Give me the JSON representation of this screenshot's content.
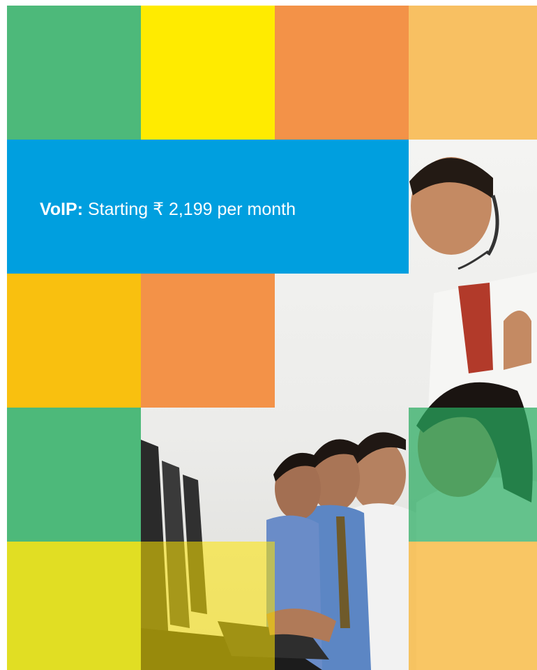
{
  "banner": {
    "label": "VoIP:",
    "text": "Starting ₹ 2,199 per month"
  },
  "colors": {
    "green": "#4db97a",
    "yellow": "#ffeb00",
    "orange": "#f39248",
    "light_orange": "#f8c062",
    "amber": "#f9c00f",
    "blue": "#009fdf",
    "lime": "#e1de23"
  },
  "image": {
    "subject": "call-center-agents-photo"
  }
}
